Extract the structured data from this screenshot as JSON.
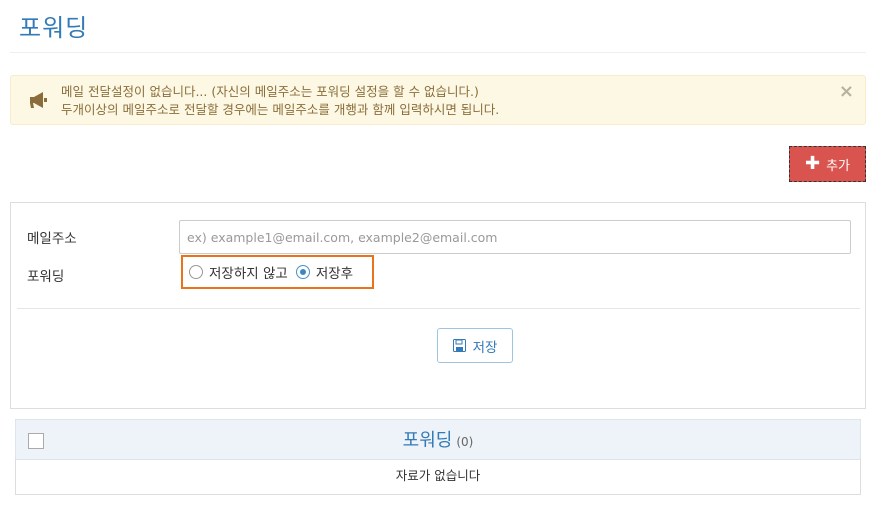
{
  "header": {
    "title": "포워딩"
  },
  "alert": {
    "line1": "메일 전달설정이 없습니다... (자신의 메일주소는 포워딩 설정을 할 수 없습니다.)",
    "line2": "두개이상의 메일주소로 전달할 경우에는 메일주소를 개행과 함께 입력하시면 됩니다.",
    "close": "×"
  },
  "toolbar": {
    "add_label": "추가"
  },
  "form": {
    "email_label": "메일주소",
    "email_placeholder": "ex) example1@email.com, example2@email.com",
    "email_value": "",
    "forward_label": "포워딩",
    "options": [
      {
        "label": "저장하지 않고",
        "selected": false
      },
      {
        "label": "저장후",
        "selected": true
      }
    ],
    "save_label": "저장"
  },
  "list": {
    "title": "포워딩",
    "count": "(0)",
    "empty_text": "자료가 없습니다"
  },
  "colors": {
    "accent": "#337ab7",
    "danger": "#d9534f",
    "warning_bg": "#fcf8e3",
    "highlight": "#e8731a"
  }
}
